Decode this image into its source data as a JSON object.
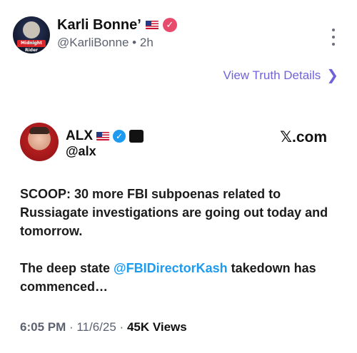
{
  "post": {
    "display_name": "Karli Bonne’",
    "handle": "@KarliBonne",
    "separator": "•",
    "age": "2h",
    "avatar_tag": "Midnight Rider",
    "more_menu": "more-options",
    "view_details_label": "View Truth Details",
    "view_details_chevron": "❯"
  },
  "quoted": {
    "name": "ALX",
    "handle": "@alx",
    "source": "𝕏.com",
    "affiliate_badge": "BREAKING NEWS"
  },
  "tweet": {
    "line1": "SCOOP: 30 more FBI subpoenas related to Russiagate investigations are going out today and tomorrow.",
    "line2_pre": "The deep state ",
    "mention": "@FBIDirectorKash",
    "line2_post": " takedown has commenced…"
  },
  "meta": {
    "time": "6:05 PM",
    "sep1": " · ",
    "date": "11/6/25",
    "sep2": " · ",
    "views_count": "45K",
    "views_label": " Views"
  },
  "icons": {
    "verified_pink": "check",
    "verified_blue": "check",
    "flag": "us-flag"
  },
  "colors": {
    "link_purple": "#6f63d9",
    "mention_blue": "#1d9bf0",
    "verified_pink": "#e84c6d"
  }
}
